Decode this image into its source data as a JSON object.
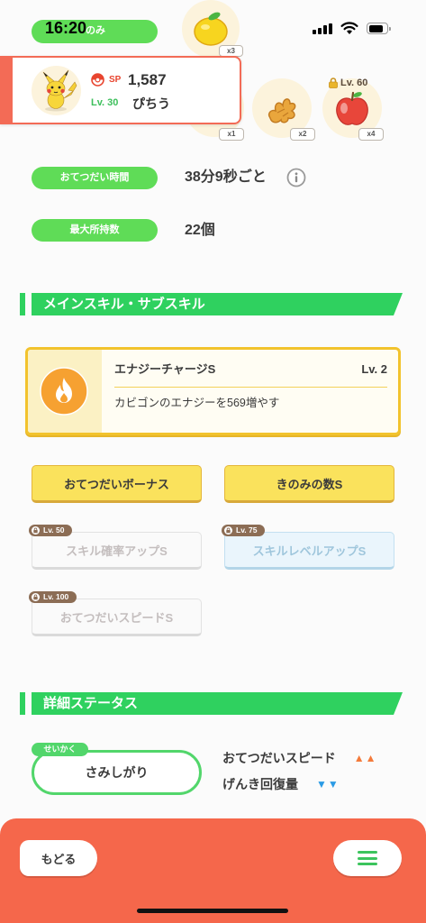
{
  "status_bar": {
    "time": "16:20",
    "signal_icon": "signal-icon",
    "wifi_icon": "wifi-icon",
    "battery_icon": "battery-icon"
  },
  "header_chip": {
    "label": "のみ"
  },
  "berry": {
    "icon": "lemon-berry-icon",
    "count": "x3"
  },
  "pokemon": {
    "image": "pikachu-icon",
    "sp_icon": "pokeball-icon",
    "sp_label": "SP",
    "sp_value": "1,587",
    "level": "Lv. 30",
    "name": "ぴちう"
  },
  "ingredients": [
    {
      "count": "x1"
    },
    {
      "icon": "ginger-icon",
      "count": "x2"
    },
    {
      "icon": "apple-icon",
      "count": "x4",
      "lock_icon": "lock-icon",
      "unlock_level": "Lv. 60"
    }
  ],
  "stats": {
    "help_time": {
      "label": "おてつだい時間",
      "value": "38分9秒ごと",
      "info_icon": "info-icon"
    },
    "max_carry": {
      "label": "最大所持数",
      "value": "22個"
    }
  },
  "skills_section": {
    "title": "メインスキル・サブスキル"
  },
  "main_skill": {
    "icon": "flame-icon",
    "name": "エナジーチャージS",
    "level": "Lv. 2",
    "description": "カビゴンのエナジーを569増やす"
  },
  "sub_skills": [
    {
      "label": "おてつだいボーナス",
      "state": "unlocked",
      "tint": "yellow"
    },
    {
      "label": "きのみの数S",
      "state": "unlocked",
      "tint": "yellow"
    },
    {
      "label": "スキル確率アップS",
      "state": "locked",
      "tint": "gray",
      "unlock_level": "Lv. 50"
    },
    {
      "label": "スキルレベルアップS",
      "state": "locked",
      "tint": "blue",
      "unlock_level": "Lv. 75"
    },
    {
      "label": "おてつだいスピードS",
      "state": "locked",
      "tint": "gray",
      "unlock_level": "Lv. 100"
    }
  ],
  "details_section": {
    "title": "詳細ステータス"
  },
  "nature": {
    "tag": "せいかく",
    "value": "さみしがり",
    "up_stat": "おてつだいスピード",
    "up_marks": "▲▲",
    "down_stat": "げんき回復量",
    "down_marks": "▼▼"
  },
  "footer": {
    "back_label": "もどる",
    "menu_icon": "hamburger-icon"
  },
  "colors": {
    "label_green": "#5fdc57",
    "banner_green": "#2fd15f",
    "card_accent": "#f36b56",
    "skill_border": "#f2c32d",
    "footer": "#f5674b",
    "up_arrow": "#f47a3a",
    "down_arrow": "#2b9be5"
  }
}
